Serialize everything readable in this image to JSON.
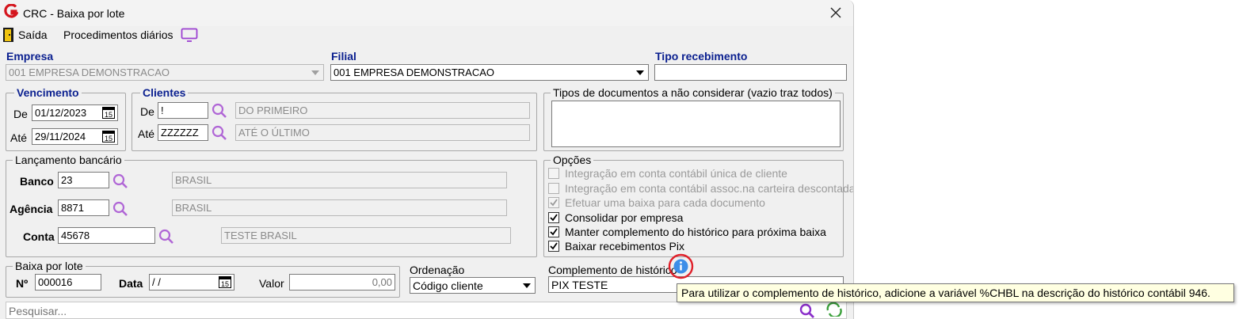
{
  "window": {
    "title": "CRC - Baixa por lote"
  },
  "menu": {
    "exit_label": "Saída",
    "procedures_label": "Procedimentos diários"
  },
  "empresa": {
    "label": "Empresa",
    "value": "001 EMPRESA DEMONSTRACAO"
  },
  "filial": {
    "label": "Filial",
    "value": "001 EMPRESA DEMONSTRACAO"
  },
  "tipo_recebimento": {
    "label": "Tipo recebimento",
    "value": ""
  },
  "vencimento": {
    "title": "Vencimento",
    "de_label": "De",
    "de_value": "01/12/2023",
    "ate_label": "Até",
    "ate_value": "29/11/2024"
  },
  "clientes": {
    "title": "Clientes",
    "de_label": "De",
    "de_value": "!",
    "de_desc": "DO PRIMEIRO",
    "ate_label": "Até",
    "ate_value": "ZZZZZZ",
    "ate_desc": "ATÉ O ÚLTIMO"
  },
  "tipos_documentos": {
    "title": "Tipos de documentos a não considerar (vazio traz todos)",
    "value": ""
  },
  "lancamento": {
    "title": "Lançamento bancário",
    "banco_label": "Banco",
    "banco_value": "23",
    "banco_desc": "BRASIL",
    "agencia_label": "Agência",
    "agencia_value": "8871",
    "agencia_desc": "BRASIL",
    "conta_label": "Conta",
    "conta_value": "45678",
    "conta_desc": "TESTE BRASIL"
  },
  "opcoes": {
    "title": "Opções",
    "items": [
      {
        "label": "Integração em conta contábil única de cliente",
        "checked": false,
        "enabled": false
      },
      {
        "label": "Integração em conta contábil assoc.na carteira descontada",
        "checked": false,
        "enabled": false
      },
      {
        "label": "Efetuar uma baixa para cada documento",
        "checked": true,
        "enabled": false
      },
      {
        "label": "Consolidar por empresa",
        "checked": true,
        "enabled": true
      },
      {
        "label": "Manter complemento do histórico para próxima baixa",
        "checked": true,
        "enabled": true
      },
      {
        "label": "Baixar recebimentos Pix",
        "checked": true,
        "enabled": true
      }
    ]
  },
  "baixa_lote": {
    "title": "Baixa por lote",
    "numero_label": "Nº",
    "numero_value": "000016",
    "data_label": "Data",
    "data_value": " / /",
    "valor_label": "Valor",
    "valor_value": "0,00"
  },
  "ordenacao": {
    "label": "Ordenação",
    "value": "Código cliente"
  },
  "complemento": {
    "label": "Complemento de histórico",
    "value": "PIX TESTE"
  },
  "tooltip": {
    "text": "Para utilizar o complemento de histórico, adicione a variável %CHBL na descrição do histórico contábil 946."
  },
  "search": {
    "placeholder": "Pesquisar..."
  },
  "colors": {
    "accent_blue": "#0a1f8f",
    "search_purple": "#b066d6",
    "info_ring": "#e0202a",
    "info_blue": "#3c8ee8",
    "tooltip_bg": "#ffffe1"
  }
}
